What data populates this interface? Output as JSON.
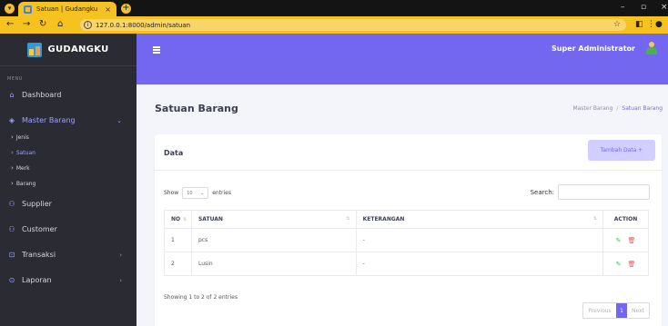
{
  "browser": {
    "tab_title": "Satuan | Gudangku",
    "tab_close": "×",
    "new_tab": "+",
    "url": "127.0.0.1:8000/admin/satuan",
    "win_min": "–",
    "win_max": "▫",
    "win_close": "×"
  },
  "sidebar": {
    "brand": "GUDANGKU",
    "menu_label": "MENU",
    "items": [
      {
        "label": "Dashboard"
      },
      {
        "label": "Master Barang"
      },
      {
        "label": "Supplier"
      },
      {
        "label": "Customer"
      },
      {
        "label": "Transaksi"
      },
      {
        "label": "Laporan"
      }
    ],
    "sub_items": [
      {
        "label": "Jenis"
      },
      {
        "label": "Satuan"
      },
      {
        "label": "Merk"
      },
      {
        "label": "Barang"
      }
    ]
  },
  "topbar": {
    "user": "Super Administrator"
  },
  "page": {
    "title": "Satuan Barang",
    "breadcrumb": [
      "Master Barang",
      "Satuan Barang"
    ],
    "breadcrumb_sep": "/"
  },
  "card": {
    "title": "Data",
    "add_button": "Tambah Data +",
    "show_label": "Show",
    "entries_value": "10",
    "entries_label": "entries",
    "search_label": "Search:",
    "search_value": "",
    "columns": [
      "NO",
      "SATUAN",
      "KETERANGAN",
      "ACTION"
    ],
    "rows": [
      {
        "no": "1",
        "satuan": "pcs",
        "keterangan": "-"
      },
      {
        "no": "2",
        "satuan": "Lusin",
        "keterangan": "-"
      }
    ],
    "info": "Showing 1 to 2 of 2 entries",
    "pager": {
      "prev": "Previous",
      "page": "1",
      "next": "Next"
    }
  },
  "colors": {
    "accent": "#7367f0",
    "sidebar_bg": "#2b2c33",
    "browser_chrome": "#f5c21f"
  }
}
